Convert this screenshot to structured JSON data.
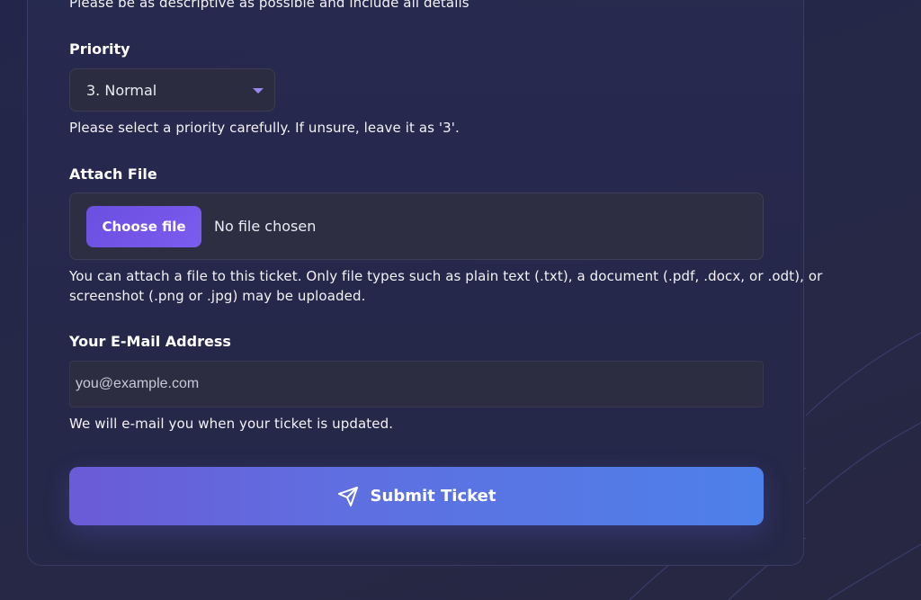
{
  "form": {
    "description_hint": "Please be as descriptive as possible and include all details",
    "priority": {
      "label": "Priority",
      "selected": "3. Normal",
      "hint": "Please select a priority carefully. If unsure, leave it as '3'."
    },
    "attachment": {
      "label": "Attach File",
      "button_label": "Choose file",
      "status": "No file chosen",
      "hint_line1": "You can attach a file to this ticket. Only file types such as plain text (.txt), a document (.pdf, .docx, or .odt), or",
      "hint_line2": "screenshot (.png or .jpg) may be uploaded."
    },
    "email": {
      "label": "Your E-Mail Address",
      "placeholder": "you@example.com",
      "value": "",
      "hint": "We will e-mail you when your ticket is updated."
    },
    "submit": {
      "label": "Submit Ticket",
      "icon": "send-icon"
    }
  },
  "colors": {
    "background": "#25274a",
    "accent": "#6a4fe0",
    "submit_gradient_start": "#6a5bd6",
    "submit_gradient_end": "#4e80ea",
    "caret": "#9a88ee"
  }
}
